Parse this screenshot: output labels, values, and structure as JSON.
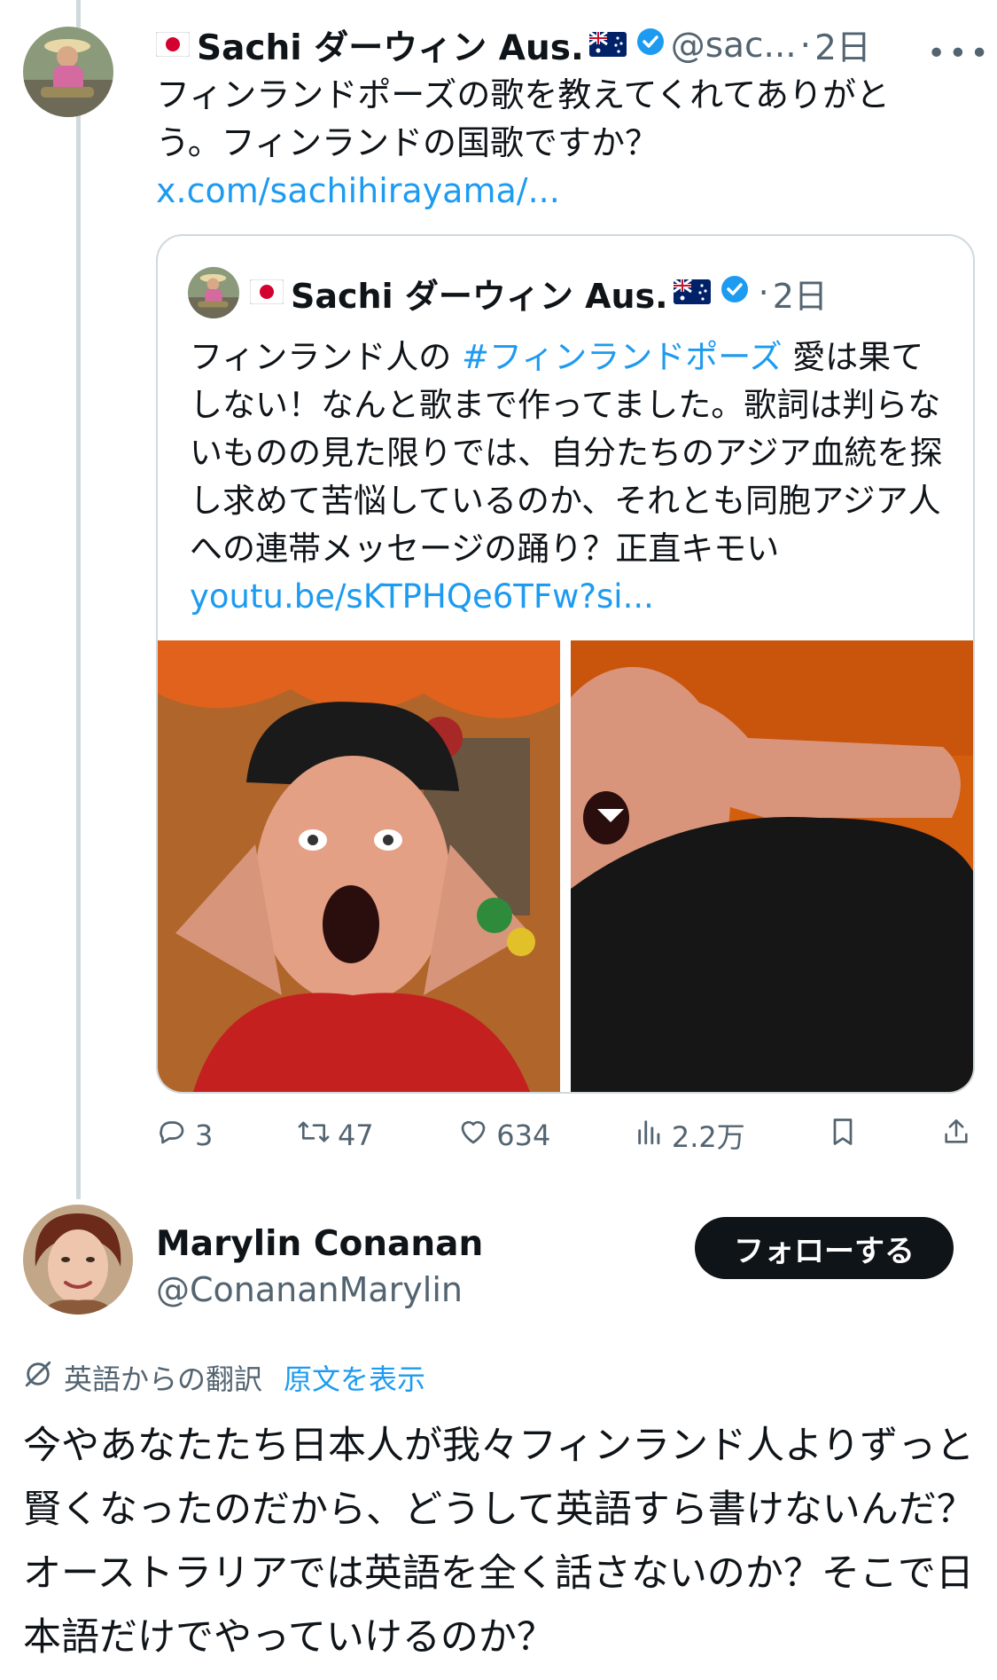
{
  "quoting_tweet": {
    "author_name": "Sachi ダーウィン Aus.",
    "handle": "@sac...",
    "dot": "·",
    "time": "2日",
    "text": "フィンランドポーズの歌を教えてくれてありがとう。フィンランドの国歌ですか？",
    "link": "x.com/sachihirayama/..."
  },
  "quoted_tweet": {
    "author_name": "Sachi ダーウィン Aus.",
    "dot": "·",
    "time": "2日",
    "text_before_hashtag": "フィンランド人の ",
    "hashtag": "#フィンランドポーズ",
    "text_after_hashtag": " 愛は果てしない！なんと歌まで作ってました。歌詞は判らないものの見た限りでは、自分たちのアジア血統を探し求めて苦悩しているのか、それとも同胞アジア人への連帯メッセージの踊り？正直キモい",
    "link": "youtu.be/sKTPHQe6TFw?si..."
  },
  "actions": {
    "replies": "3",
    "retweets": "47",
    "likes": "634",
    "views": "2.2万"
  },
  "reply": {
    "author_name": "Marylin Conanan",
    "handle": "@ConananMarylin",
    "follow_label": "フォローする",
    "translation_note": "英語からの翻訳",
    "show_original": "原文を表示",
    "text": "今やあなたたち日本人が我々フィンランド人よりずっと賢くなったのだから、どうして英語すら書けないんだ？オーストラリアでは英語を全く話さないのか？そこで日本語だけでやっていけるのか？"
  },
  "colors": {
    "link": "#1d9bf0",
    "muted": "#536471",
    "verified": "#1d9bf0",
    "follow_button_bg": "#0f1419"
  }
}
